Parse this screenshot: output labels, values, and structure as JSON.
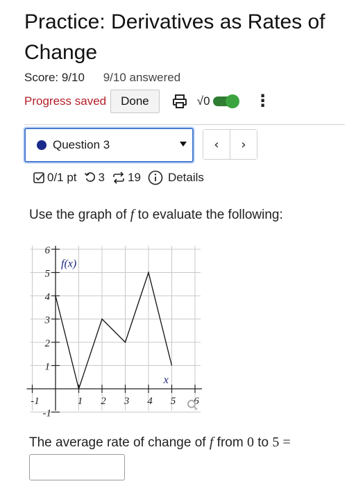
{
  "header": {
    "title": "Practice: Derivatives as Rates of Change",
    "score": "Score: 9/10",
    "answered": "9/10 answered",
    "progress_saved": "Progress saved",
    "done_label": "Done",
    "sqrt_label": "√0"
  },
  "question_select": {
    "selected": "Question 3"
  },
  "nav": {
    "prev": "‹",
    "next": "›"
  },
  "meta": {
    "points": "0/1 pt",
    "retries": "3",
    "attempts": "19",
    "details": "Details"
  },
  "prompt": {
    "before": "Use the graph of ",
    "var": "f",
    "after": " to evaluate the following:"
  },
  "graph": {
    "function_label": "f(x)",
    "x_axis_label": "x",
    "x_ticks": [
      "-1",
      "1",
      "2",
      "3",
      "4",
      "5",
      "6"
    ],
    "y_ticks": [
      "6",
      "5",
      "4",
      "3",
      "2",
      "1",
      "-1"
    ],
    "points": [
      [
        0,
        4
      ],
      [
        1,
        0
      ],
      [
        2,
        3
      ],
      [
        3,
        2
      ],
      [
        4,
        5
      ],
      [
        5,
        1
      ]
    ],
    "xlim": [
      -1,
      6
    ],
    "ylim": [
      -1,
      6
    ],
    "grid": true
  },
  "question2": {
    "before": "The average rate of change of ",
    "var": "f",
    "mid": " from ",
    "a": "0",
    "to": " to ",
    "b": "5",
    "eq": " ="
  },
  "colors": {
    "accent": "#4a7bd0",
    "saved": "#b3202a",
    "toggle": "#3ca43f",
    "func_label": "#1a237e"
  }
}
